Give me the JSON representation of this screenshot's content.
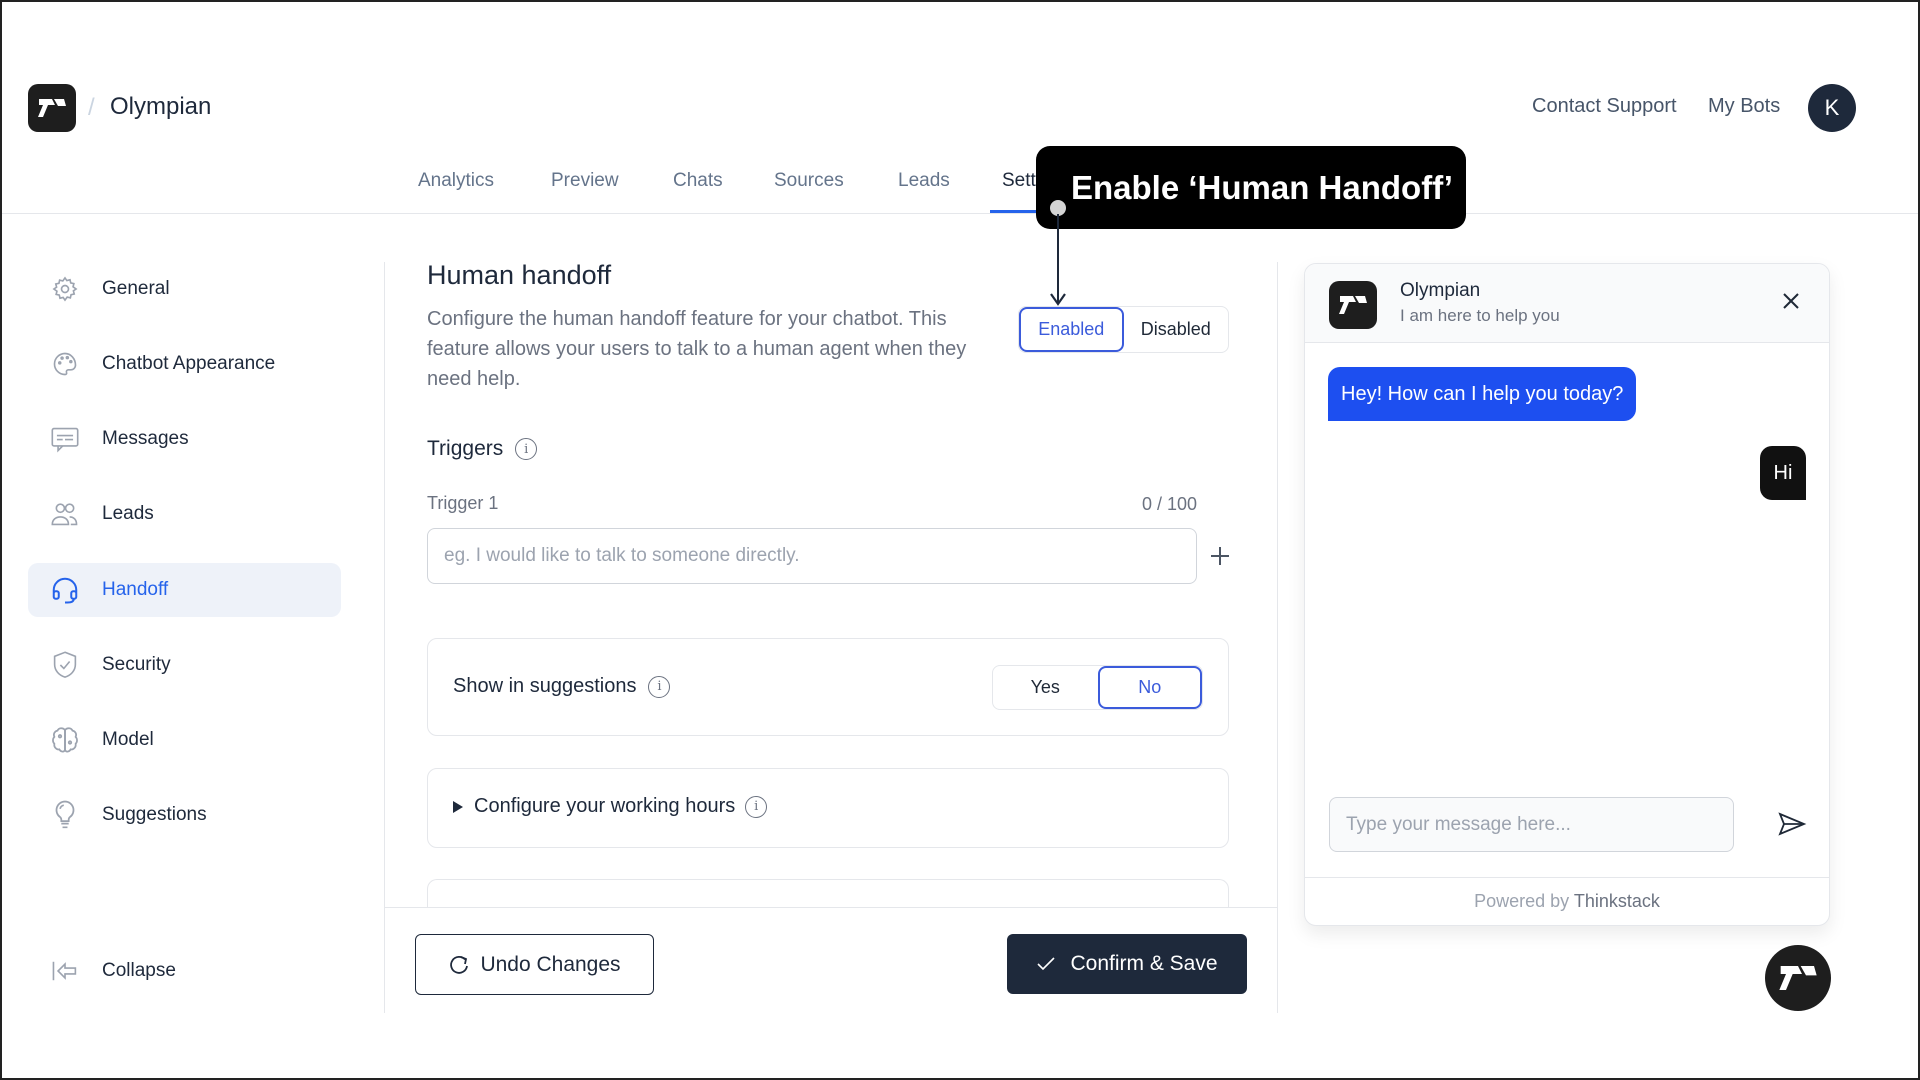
{
  "header": {
    "app_title": "Olympian",
    "breadcrumb_separator": "/",
    "links": [
      "Contact Support",
      "My Bots"
    ],
    "avatar_initial": "K"
  },
  "tabs": [
    {
      "label": "Analytics",
      "active": false
    },
    {
      "label": "Preview",
      "active": false
    },
    {
      "label": "Chats",
      "active": false
    },
    {
      "label": "Sources",
      "active": false
    },
    {
      "label": "Leads",
      "active": false
    },
    {
      "label": "Settings",
      "active": true
    }
  ],
  "callout": {
    "text": "Enable ‘Human Handoff’"
  },
  "sidebar": {
    "items": [
      {
        "label": "General",
        "icon": "gear-icon",
        "active": false
      },
      {
        "label": "Chatbot Appearance",
        "icon": "palette-icon",
        "active": false
      },
      {
        "label": "Messages",
        "icon": "message-icon",
        "active": false
      },
      {
        "label": "Leads",
        "icon": "users-icon",
        "active": false
      },
      {
        "label": "Handoff",
        "icon": "headset-icon",
        "active": true
      },
      {
        "label": "Security",
        "icon": "shield-check-icon",
        "active": false
      },
      {
        "label": "Model",
        "icon": "brain-icon",
        "active": false
      },
      {
        "label": "Suggestions",
        "icon": "lightbulb-icon",
        "active": false
      }
    ],
    "collapse_label": "Collapse"
  },
  "content": {
    "title": "Human handoff",
    "description": "Configure the human handoff feature for your chatbot. This feature allows your users to talk to a human agent when they need help.",
    "status_toggle": {
      "options": [
        "Enabled",
        "Disabled"
      ],
      "selected": "Enabled"
    },
    "triggers": {
      "title": "Triggers",
      "items": [
        {
          "label": "Trigger 1",
          "counter": "0 / 100",
          "value": "",
          "placeholder": "eg. I would like to talk to someone directly."
        }
      ]
    },
    "show_in_suggestions": {
      "label": "Show in suggestions",
      "options": [
        "Yes",
        "No"
      ],
      "selected": "No"
    },
    "working_hours": {
      "label": "Configure your working hours",
      "expanded": false
    },
    "buttons": {
      "undo": "Undo Changes",
      "save": "Confirm & Save"
    }
  },
  "chat_preview": {
    "bot_name": "Olympian",
    "bot_subtitle": "I am here to help you",
    "messages": [
      {
        "from": "bot",
        "text": "Hey! How can I help you today?"
      },
      {
        "from": "user",
        "text": "Hi"
      }
    ],
    "input_placeholder": "Type your message here...",
    "powered_by_prefix": "Powered by",
    "powered_by_brand": "Thinkstack"
  },
  "colors": {
    "accent": "#2563eb",
    "bot_bubble": "#1d4ff0",
    "primary_button": "#1e293b",
    "callout_bg": "#000000"
  }
}
